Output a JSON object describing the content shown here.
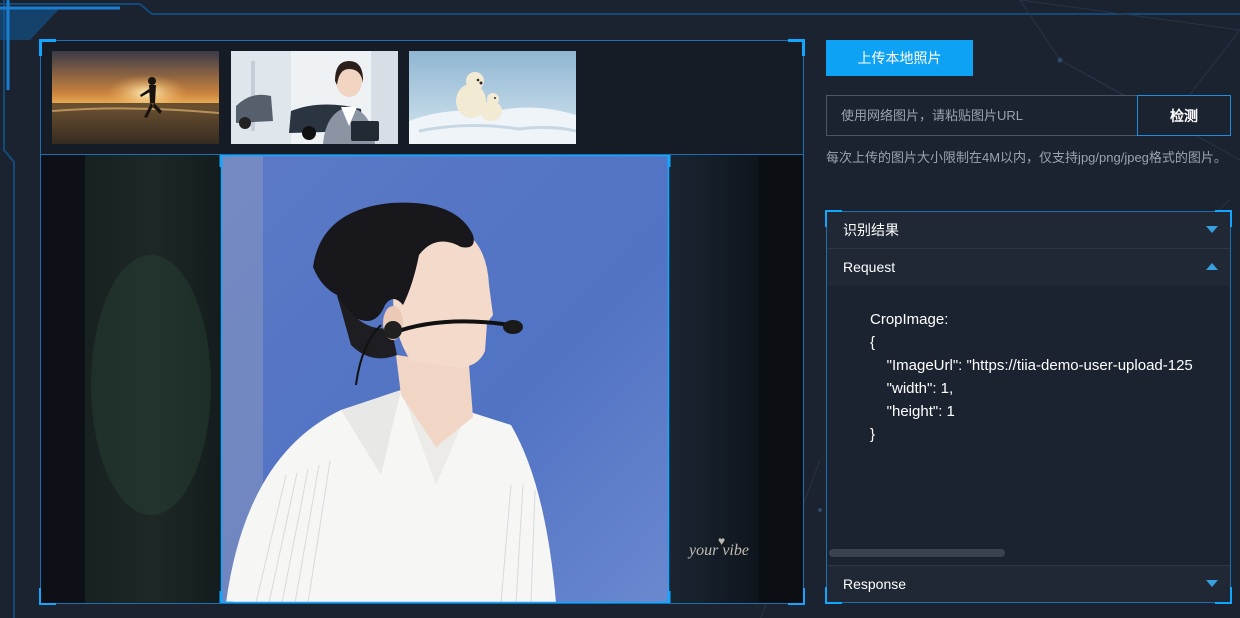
{
  "thumbnails": [
    {
      "name": "sunset-runner",
      "selected": false
    },
    {
      "name": "businesswoman-car-showroom",
      "selected": false
    },
    {
      "name": "polar-bears-on-ice",
      "selected": false
    }
  ],
  "preview": {
    "watermark": "your vibe",
    "watermark_icon": "heart-icon"
  },
  "upload_button_label": "上传本地照片",
  "url_input": {
    "value": "",
    "placeholder": "使用网络图片，请粘贴图片URL"
  },
  "detect_button_label": "检测",
  "hint_text": "每次上传的图片大小限制在4M以内，仅支持jpg/png/jpeg格式的图片。",
  "result_panel": {
    "title": "识别结果",
    "request_label": "Request",
    "response_label": "Response",
    "request_code": "CropImage:\n{\n    \"ImageUrl\": \"https://tiia-demo-user-upload-125\n    \"width\": 1,\n    \"height\": 1\n}"
  },
  "colors": {
    "accent": "#0da2f3",
    "frame_border": "#1e6fb0",
    "background": "#1c2330",
    "hint_text": "#9aa3b0"
  }
}
